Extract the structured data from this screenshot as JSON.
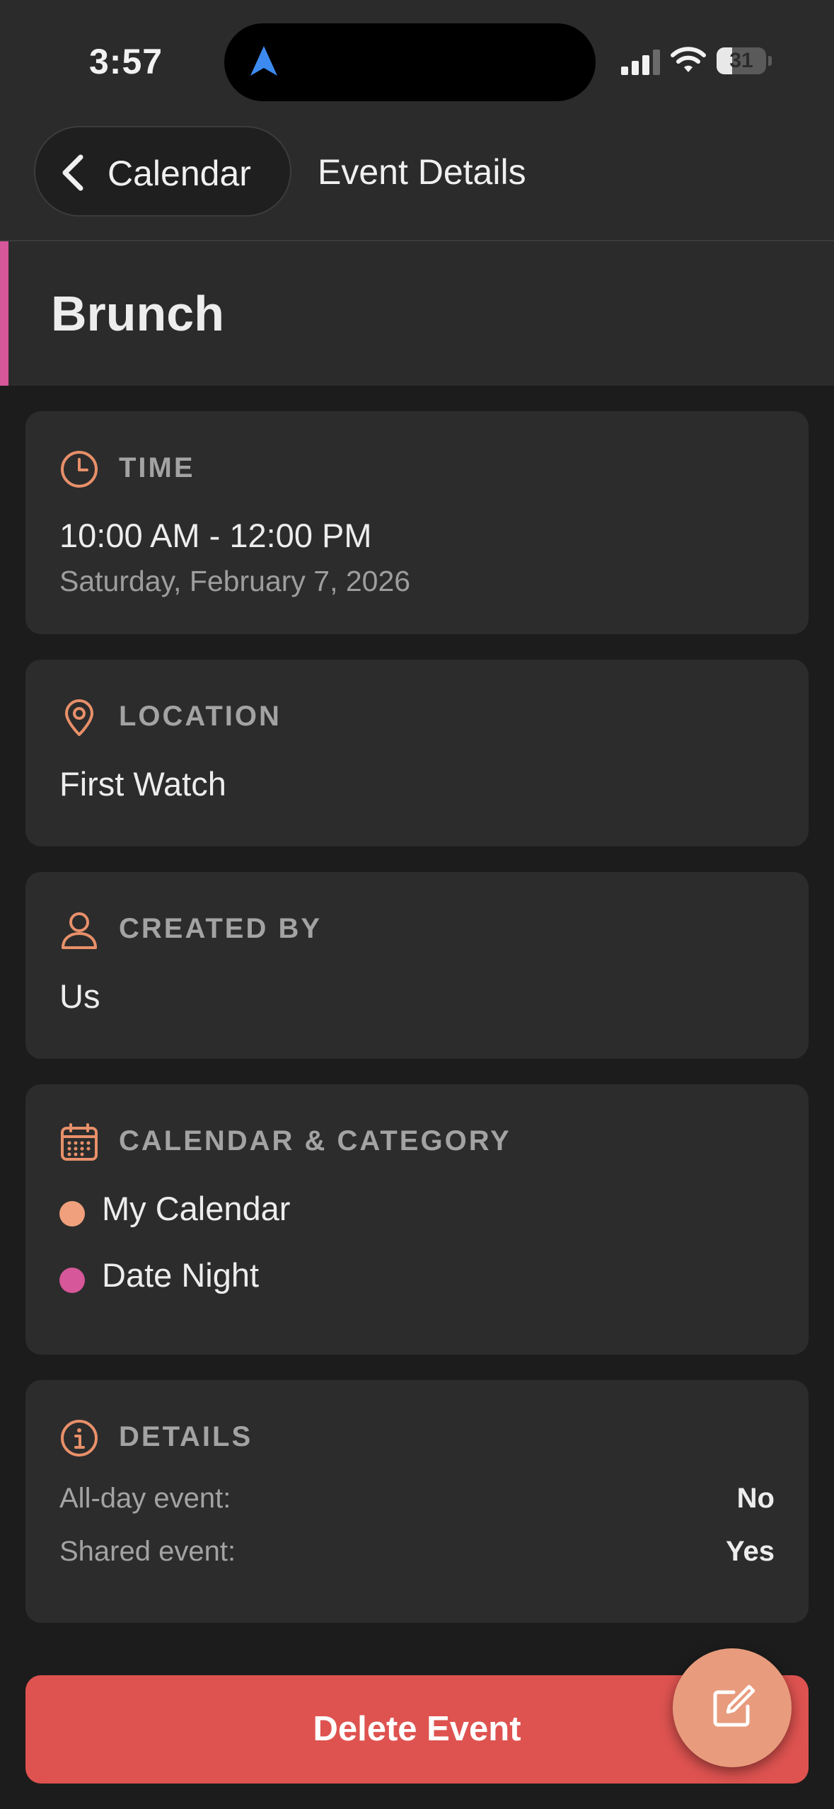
{
  "status_bar": {
    "time": "3:57",
    "battery_level": "31",
    "battery_fraction": 0.31,
    "icons": [
      "location-arrow-icon",
      "cellular-signal-icon",
      "wifi-icon",
      "battery-icon"
    ]
  },
  "header": {
    "back_label": "Calendar",
    "title": "Event Details",
    "back_icon": "chevron-left-icon"
  },
  "event": {
    "title": "Brunch",
    "accent_color": "#d6579a"
  },
  "time_card": {
    "icon": "clock-icon",
    "label": "TIME",
    "time_range": "10:00 AM - 12:00 PM",
    "date": "Saturday, February 7, 2026"
  },
  "location_card": {
    "icon": "map-pin-icon",
    "label": "LOCATION",
    "value": "First Watch"
  },
  "created_card": {
    "icon": "person-icon",
    "label": "CREATED BY",
    "value": "Us"
  },
  "calendar_card": {
    "icon": "calendar-icon",
    "label": "CALENDAR & CATEGORY",
    "items": [
      {
        "name": "My Calendar",
        "color": "#f0a07c"
      },
      {
        "name": "Date Night",
        "color": "#d6579a"
      }
    ]
  },
  "details_card": {
    "icon": "info-icon",
    "label": "DETAILS",
    "rows": [
      {
        "label": "All-day event:",
        "value": "No"
      },
      {
        "label": "Shared event:",
        "value": "Yes"
      }
    ]
  },
  "actions": {
    "delete_label": "Delete Event",
    "edit_icon": "edit-icon"
  },
  "colors": {
    "accent": "#e8906a",
    "delete": "#de5350",
    "fab": "#e89c7d"
  }
}
